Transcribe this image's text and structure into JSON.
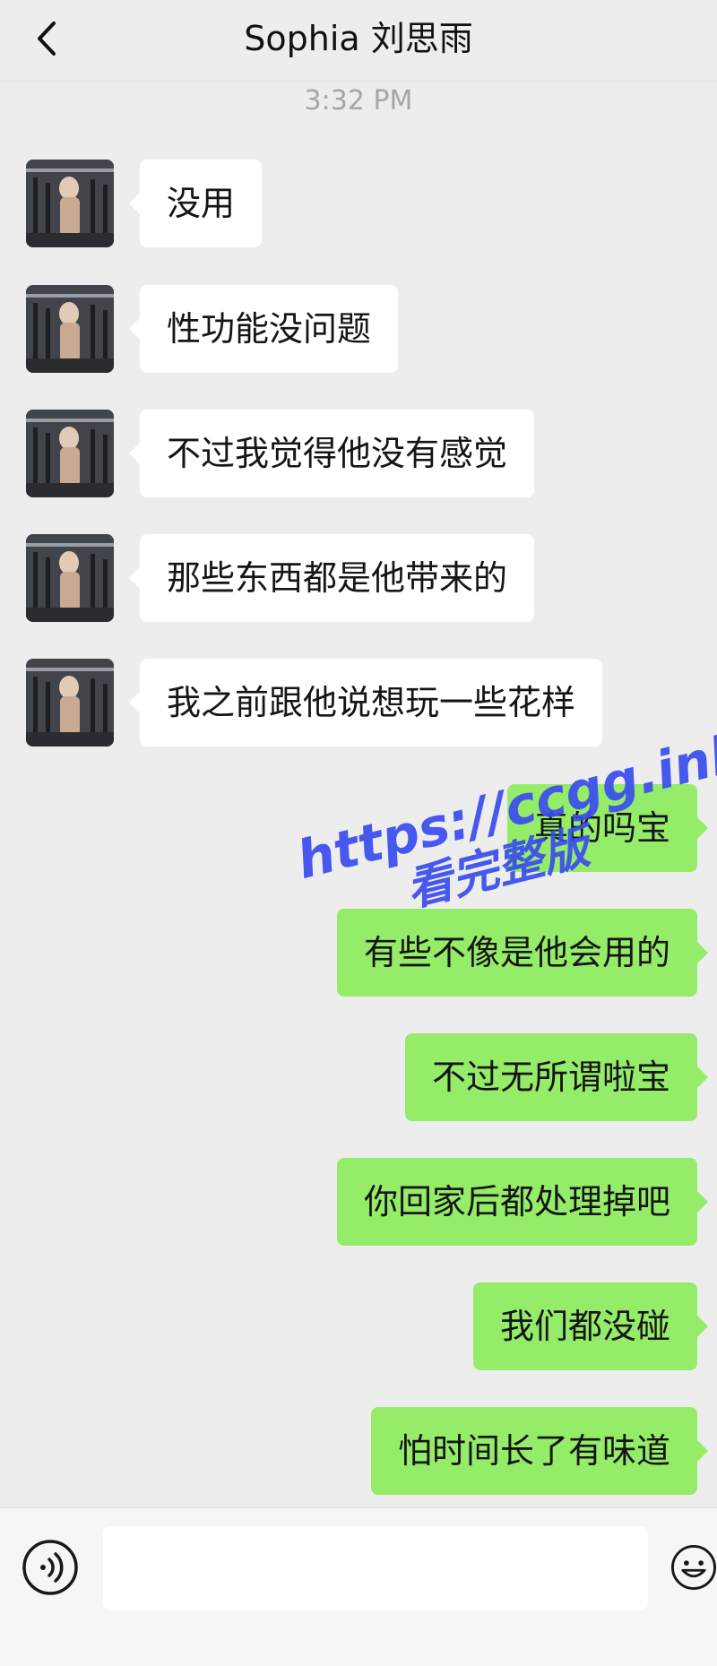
{
  "header": {
    "title": "Sophia 刘思雨",
    "back_icon": "chevron-left-icon"
  },
  "chat": {
    "timestamp": "3:32 PM",
    "incoming": [
      {
        "text": "没用"
      },
      {
        "text": "性功能没问题"
      },
      {
        "text": "不过我觉得他没有感觉"
      },
      {
        "text": "那些东西都是他带来的"
      },
      {
        "text": "我之前跟他说想玩一些花样"
      }
    ],
    "outgoing": [
      {
        "text": "真的吗宝"
      },
      {
        "text": "有些不像是他会用的"
      },
      {
        "text": "不过无所谓啦宝"
      },
      {
        "text": "你回家后都处理掉吧"
      },
      {
        "text": "我们都没碰"
      },
      {
        "text": "怕时间长了有味道"
      }
    ]
  },
  "watermark": {
    "url": "https://ccgg.ink",
    "text": "看完整版"
  },
  "input_bar": {
    "value": "",
    "voice_icon": "voice-icon",
    "emoji_icon": "emoji-icon"
  },
  "colors": {
    "background": "#ededed",
    "incoming_bubble": "#ffffff",
    "outgoing_bubble": "#95ec69",
    "watermark": "#3a4cf0"
  }
}
